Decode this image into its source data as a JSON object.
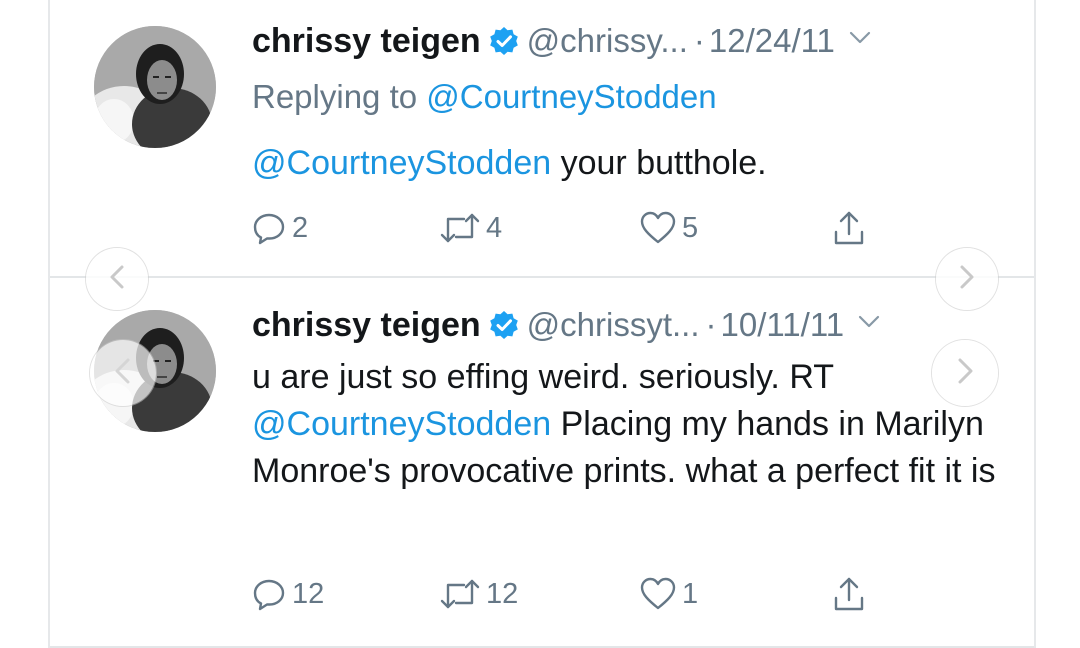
{
  "tweets": [
    {
      "name": "chrissy teigen",
      "handle": "@chrissy...",
      "separator": "·",
      "date": "12/24/11",
      "replying_prefix": "Replying to ",
      "replying_handle": "@CourtneyStodden",
      "mention": "@CourtneyStodden",
      "text_after_mention": " your butthole.",
      "counts": {
        "reply": "2",
        "retweet": "4",
        "like": "5"
      }
    },
    {
      "name": "chrissy teigen",
      "handle": "@chrissyt...",
      "separator": "·",
      "date": "10/11/11",
      "text_before_mention": "u are just so effing weird. seriously. RT ",
      "mention": "@CourtneyStodden",
      "text_after_mention": " Placing my hands in Marilyn Monroe's provocative prints. what a perfect fit it is",
      "counts": {
        "reply": "12",
        "retweet": "12",
        "like": "1"
      }
    }
  ],
  "icons": {
    "verified": "verified-badge-icon",
    "caret": "chevron-down-icon",
    "reply": "reply-icon",
    "retweet": "retweet-icon",
    "like": "heart-icon",
    "share": "share-icon",
    "prev": "chevron-left-icon",
    "next": "chevron-right-icon"
  },
  "colors": {
    "link": "#1b95e0",
    "secondary_text": "#657786",
    "primary_text": "#14171a",
    "verified": "#1da1f2"
  }
}
